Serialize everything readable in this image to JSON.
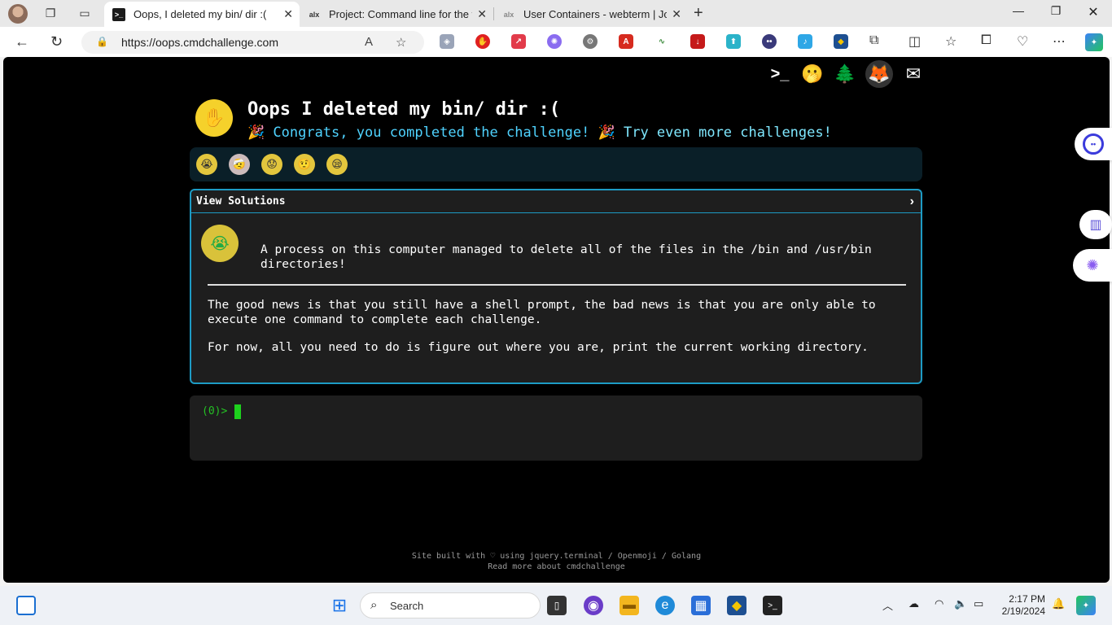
{
  "browser": {
    "tabs": [
      {
        "label": "Oops, I deleted my bin/ dir :(",
        "favicon": "terminal-icon",
        "active": true
      },
      {
        "label": "Project: Command line for the w",
        "favicon": "alx-icon",
        "active": false
      },
      {
        "label": "User Containers - webterm | Joha",
        "favicon": "alx-icon",
        "active": false
      }
    ],
    "url": "https://oops.cmdchallenge.com",
    "new_tab": "+"
  },
  "page": {
    "title": "Oops I deleted my bin/ dir :(",
    "congrats": "🎉 Congrats, you completed the challenge! 🎉",
    "more_link": "Try even more challenges!",
    "panel_header": "View Solutions",
    "intro": "A process on this computer managed to delete all of the files in the /bin and /usr/bin directories!",
    "para1": "The good news is that you still have a shell prompt, the bad news is that you are only able to execute one command to complete each challenge.",
    "para2": "For now, all you need to do is figure out where you are, print the current working directory.",
    "prompt": "(0)>",
    "footer_line1": "Site built with ♡ using jquery.terminal / Openmoji / Golang",
    "footer_line2": "Read more about cmdchallenge"
  },
  "taskbar": {
    "search_label": "Search",
    "time": "2:17 PM",
    "date": "2/19/2024"
  },
  "colors": {
    "accent_cyan": "#4fd3ff",
    "panel_border": "#1d9bc4",
    "prompt_green": "#24c124"
  }
}
